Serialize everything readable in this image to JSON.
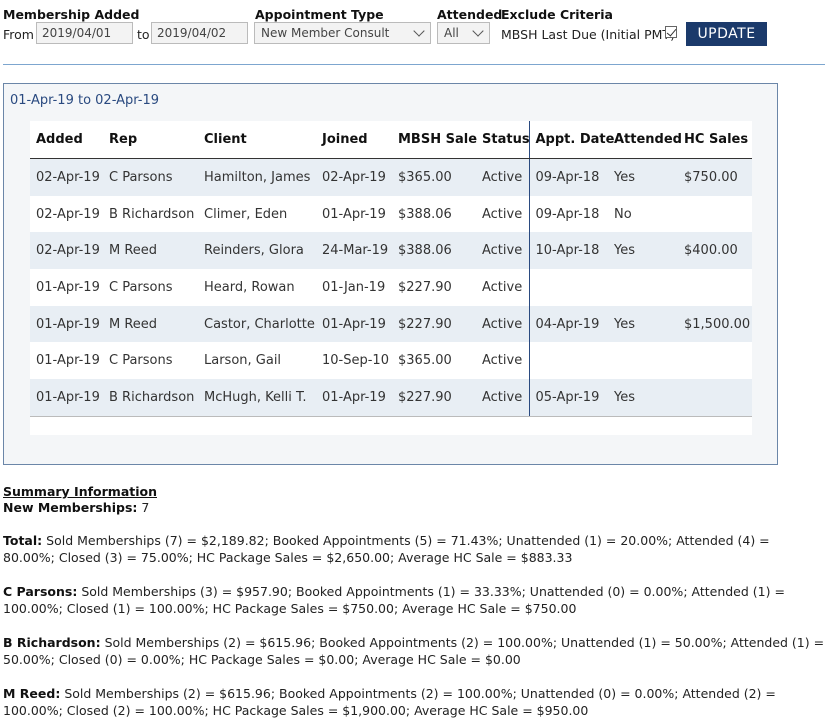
{
  "filters": {
    "membership_added_label": "Membership Added",
    "from_label": "From",
    "from_value": "2019/04/01",
    "to_label": "to",
    "to_value": "2019/04/02",
    "appointment_type_label": "Appointment Type",
    "appointment_type_value": "New Member Consult",
    "attended_label": "Attended",
    "attended_value": "All",
    "exclude_label": "Exclude Criteria",
    "exclude_option": "MBSH Last Due (Initial PMT)",
    "exclude_checked": true,
    "update_label": "UPDATE"
  },
  "panel": {
    "title": "01-Apr-19 to 02-Apr-19"
  },
  "table": {
    "columns": [
      "Added",
      "Rep",
      "Client",
      "Joined",
      "MBSH Sale",
      "Status",
      "Appt. Date",
      "Attended",
      "HC Sales"
    ],
    "rows": [
      [
        "02-Apr-19",
        "C Parsons",
        "Hamilton, James",
        "02-Apr-19",
        "$365.00",
        "Active",
        "09-Apr-18",
        "Yes",
        "$750.00"
      ],
      [
        "02-Apr-19",
        "B Richardson",
        "Climer, Eden",
        "01-Apr-19",
        "$388.06",
        "Active",
        "09-Apr-18",
        "No",
        ""
      ],
      [
        "02-Apr-19",
        "M Reed",
        "Reinders, Glora",
        "24-Mar-19",
        "$388.06",
        "Active",
        "10-Apr-18",
        "Yes",
        "$400.00"
      ],
      [
        "01-Apr-19",
        "C Parsons",
        "Heard, Rowan",
        "01-Jan-19",
        "$227.90",
        "Active",
        "",
        "",
        ""
      ],
      [
        "01-Apr-19",
        "M Reed",
        "Castor, Charlotte",
        "01-Apr-19",
        "$227.90",
        "Active",
        "04-Apr-19",
        "Yes",
        "$1,500.00"
      ],
      [
        "01-Apr-19",
        "C Parsons",
        "Larson, Gail",
        "10-Sep-10",
        "$365.00",
        "Active",
        "",
        "",
        ""
      ],
      [
        "01-Apr-19",
        "B Richardson",
        "McHugh, Kelli T.",
        "01-Apr-19",
        "$227.90",
        "Active",
        "05-Apr-19",
        "Yes",
        ""
      ]
    ]
  },
  "summary": {
    "heading": "Summary Information",
    "new_memberships_label": "New Memberships:",
    "new_memberships_value": "7",
    "blocks": [
      {
        "label": "Total:",
        "text": "Sold Memberships (7) = $2,189.82; Booked Appointments (5) = 71.43%; Unattended (1) = 20.00%; Attended (4) = 80.00%; Closed (3) = 75.00%; HC Package Sales = $2,650.00; Average HC Sale = $883.33"
      },
      {
        "label": "C Parsons:",
        "text": "Sold Memberships (3) = $957.90; Booked Appointments (1) = 33.33%; Unattended (0) = 0.00%; Attended (1) = 100.00%; Closed (1) = 100.00%; HC Package Sales = $750.00; Average HC Sale = $750.00"
      },
      {
        "label": "B Richardson:",
        "text": "Sold Memberships (2) = $615.96; Booked Appointments (2) = 100.00%; Unattended (1) = 50.00%; Attended (1) = 50.00%; Closed (0) = 0.00%; HC Package Sales = $0.00; Average HC Sale = $0.00"
      },
      {
        "label": "M Reed:",
        "text": "Sold Memberships (2) = $615.96; Booked Appointments (2) = 100.00%; Unattended (0) = 0.00%; Attended (2) = 100.00%; Closed (2) = 100.00%; HC Package Sales = $1,900.00; Average HC Sale = $950.00"
      }
    ]
  }
}
